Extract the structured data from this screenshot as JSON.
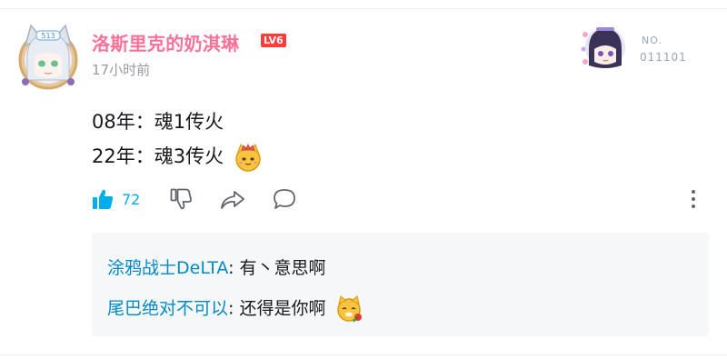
{
  "comment": {
    "username": "洛斯里克的奶淇琳",
    "level": "LV6",
    "time": "17小时前",
    "avatar_icon": "anime-girl-cat-ear-avatar",
    "fan_badge": {
      "label": "NO.",
      "number": "011101"
    },
    "content": {
      "line1": "08年：魂1传火",
      "line2": "22年：魂3传火",
      "emoji": "cat-king-emoji"
    },
    "actions": {
      "like_count": "72",
      "like_color": "#00aeec"
    }
  },
  "replies": [
    {
      "name": "涂鸦战士DeLTA",
      "text": ": 有丶意思啊"
    },
    {
      "name": "尾巴绝对不可以",
      "text": ": 还得是你啊",
      "emoji": "cat-rose-emoji"
    }
  ],
  "colors": {
    "username": "#fb7299",
    "reply_name": "#008ac5",
    "muted": "#9499a0"
  }
}
